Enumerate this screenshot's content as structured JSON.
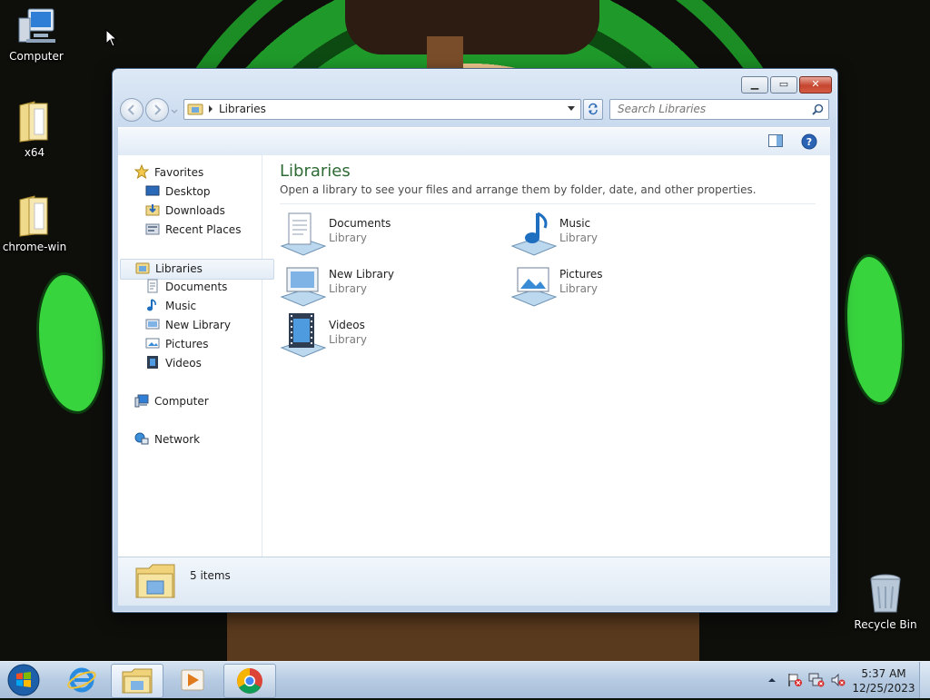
{
  "desktop": {
    "icons": [
      {
        "label": "Computer"
      },
      {
        "label": "x64"
      },
      {
        "label": "chrome-win"
      },
      {
        "label": "Recycle Bin"
      }
    ]
  },
  "window": {
    "caption": {
      "minimize": "▁",
      "maximize": "▭",
      "close": "✕"
    },
    "address": {
      "segment": "Libraries"
    },
    "search": {
      "placeholder": "Search Libraries"
    },
    "nav": {
      "favorites": {
        "label": "Favorites",
        "items": [
          "Desktop",
          "Downloads",
          "Recent Places"
        ]
      },
      "libraries": {
        "label": "Libraries",
        "items": [
          "Documents",
          "Music",
          "New Library",
          "Pictures",
          "Videos"
        ]
      },
      "computer": "Computer",
      "network": "Network"
    },
    "main": {
      "title": "Libraries",
      "description": "Open a library to see your files and arrange them by folder, date, and other properties.",
      "libraries": [
        {
          "name": "Documents",
          "type": "Library",
          "icon": "documents-library-icon"
        },
        {
          "name": "Music",
          "type": "Library",
          "icon": "music-library-icon"
        },
        {
          "name": "New Library",
          "type": "Library",
          "icon": "new-library-icon"
        },
        {
          "name": "Pictures",
          "type": "Library",
          "icon": "pictures-library-icon"
        },
        {
          "name": "Videos",
          "type": "Library",
          "icon": "videos-library-icon"
        }
      ]
    },
    "details": {
      "count": "5 items"
    }
  },
  "taskbar": {
    "clock": {
      "time": "5:37 AM",
      "date": "12/25/2023"
    },
    "apps": [
      "start-orb",
      "internet-explorer",
      "windows-explorer",
      "media-player",
      "chrome"
    ]
  }
}
